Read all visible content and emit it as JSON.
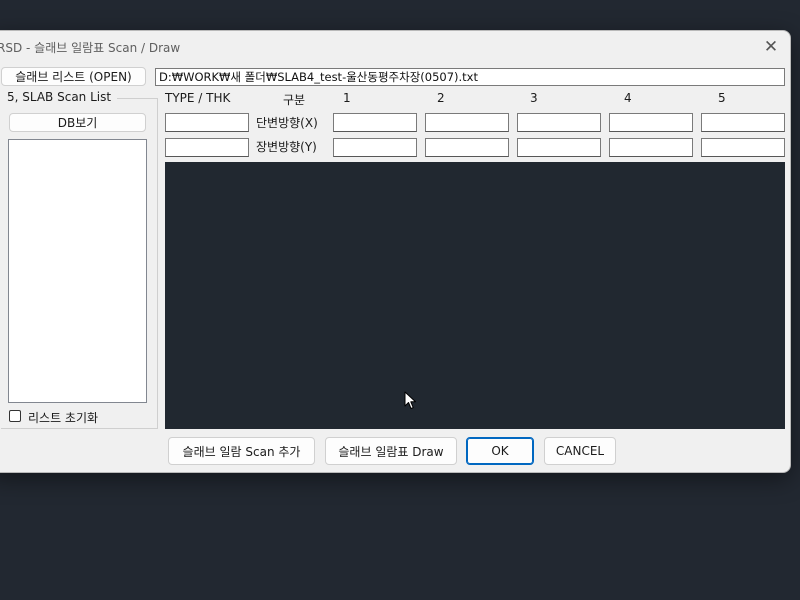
{
  "window": {
    "title": "RSD - 슬래브 일람표 Scan / Draw",
    "close_glyph": "✕"
  },
  "left_panel": {
    "open_button": "슬래브 리스트 (OPEN)",
    "group_label": "5, SLAB Scan  List",
    "db_button": "DB보기",
    "reset_checkbox_label": "리스트 초기화",
    "reset_checked": false,
    "list_items": []
  },
  "file_path": "D:₩WORK₩새 폴더₩SLAB4_test-울산동평주차장(0507).txt",
  "grid": {
    "headers": {
      "type_thk": "TYPE / THK",
      "division": "구분",
      "cols": [
        "1",
        "2",
        "3",
        "4",
        "5"
      ]
    },
    "row_x_label": "단변방향(X)",
    "row_y_label": "장변방향(Y)",
    "row_x_values": [
      "",
      "",
      "",
      "",
      "",
      ""
    ],
    "row_y_values": [
      "",
      "",
      "",
      "",
      "",
      ""
    ]
  },
  "buttons": {
    "scan_add": "슬래브 일람 Scan 추가",
    "draw": "슬래브 일람표 Draw",
    "ok": "OK",
    "cancel": "CANCEL"
  },
  "colors": {
    "canvas": "#212830",
    "accent": "#0067c0",
    "desktop": "#222831"
  }
}
